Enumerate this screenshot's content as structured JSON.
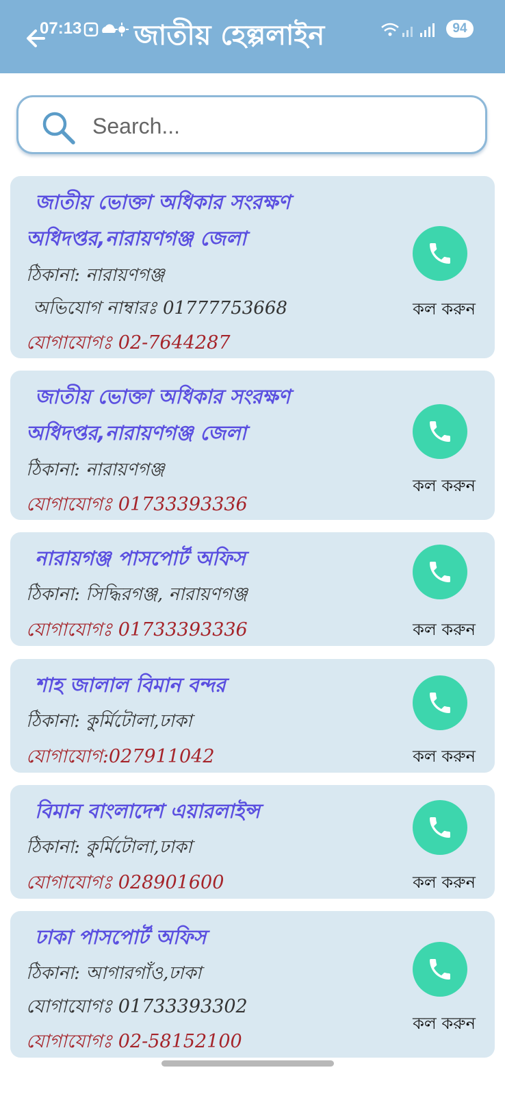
{
  "status_bar": {
    "time": "07:13",
    "battery": "94"
  },
  "header": {
    "title": "জাতীয় হেল্পলাইন"
  },
  "search": {
    "placeholder": "Search..."
  },
  "colors": {
    "header_bg": "#7fb2d8",
    "card_bg": "#d9e8f1",
    "title_color": "#5a4fe0",
    "contact_color": "#a5242a",
    "call_button": "#3dd6ad"
  },
  "entries": [
    {
      "title_line1": "জাতীয় ভোক্তা অধিকার সংরক্ষণ",
      "title_line2": "অধিদপ্তর,নারায়ণগঞ্জ জেলা",
      "address": "ঠিকানা: নারায়ণগঞ্জ",
      "complaint": "অভিযোগ নাম্বারঃ 01777753668",
      "contact": "যোগাযোগঃ  02-7644287",
      "call_label": "কল করুন"
    },
    {
      "title_line1": "জাতীয় ভোক্তা অধিকার সংরক্ষণ",
      "title_line2": "অধিদপ্তর,নারায়ণগঞ্জ জেলা",
      "address": "ঠিকানা: নারায়ণগঞ্জ",
      "contact": "যোগাযোগঃ  01733393336",
      "call_label": "কল করুন"
    },
    {
      "title_line1": "নারায়গঞ্জ পাসপোর্ট অফিস",
      "address": "ঠিকানা: সিদ্ধিরগঞ্জ, নারায়ণগঞ্জ",
      "contact": "যোগাযোগঃ  01733393336",
      "call_label": "কল করুন"
    },
    {
      "title_line1": "শাহ জালাল বিমান বন্দর",
      "address": "ঠিকানা: কুর্মিটোলা,ঢাকা",
      "contact": "যোগাযোগ:027911042",
      "call_label": "কল করুন"
    },
    {
      "title_line1": "বিমান বাংলাদেশ এয়ারলাইন্স",
      "address": "ঠিকানা: কুর্মিটোলা,ঢাকা",
      "contact": "যোগাযোগঃ  028901600",
      "call_label": "কল করুন"
    },
    {
      "title_line1": "ঢাকা পাসপোর্ট অফিস",
      "address": "ঠিকানা: আগারগাঁও,ঢাকা",
      "contact_alt": "যোগাযোগঃ 01733393302",
      "contact": "যোগাযোগঃ  02-58152100",
      "call_label": "কল করুন"
    }
  ]
}
